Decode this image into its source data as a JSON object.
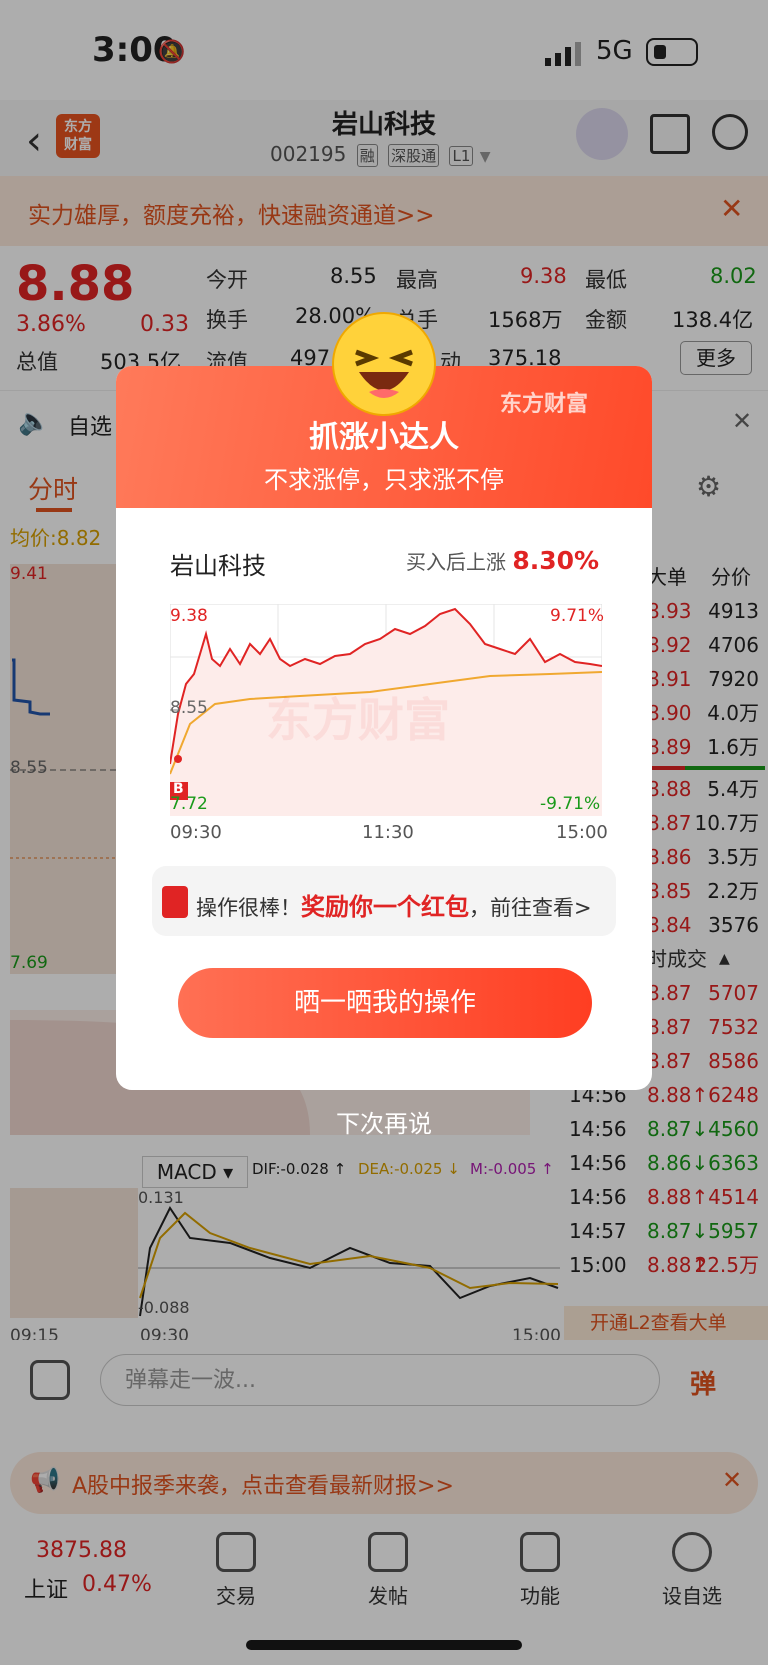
{
  "status": {
    "time": "3:00",
    "network": "5G"
  },
  "header": {
    "name": "岩山科技",
    "code": "002195",
    "tags": [
      "融",
      "深股通",
      "L1"
    ]
  },
  "logo": {
    "line1": "东方",
    "line2": "财富"
  },
  "promo": {
    "text": "实力雄厚，额度充裕，快速融资通道>>"
  },
  "quote": {
    "price": "8.88",
    "change_pct": "3.86%",
    "change": "0.33",
    "fields": [
      {
        "label": "今开",
        "value": "8.55"
      },
      {
        "label": "最高",
        "value": "9.38"
      },
      {
        "label": "最低",
        "value": "8.02"
      },
      {
        "label": "换手",
        "value": "28.00%"
      },
      {
        "label": "总手",
        "value": "1568万"
      },
      {
        "label": "金额",
        "value": "138.4亿"
      },
      {
        "label": "总值",
        "value": "503.5亿"
      },
      {
        "label": "流值",
        "value": "497"
      },
      {
        "label": "动",
        "value": "375.18"
      }
    ],
    "more": "更多"
  },
  "notice": {
    "text": "自选"
  },
  "tabs": {
    "active": "分时"
  },
  "chart_left": {
    "avg_label": "均价:",
    "avg_value": "8.82",
    "y_top": "9.41",
    "y_mid": "8.55",
    "y_bottom": "7.69",
    "t1": "09:15",
    "t2": "09:30",
    "t3": "15:00",
    "macd": "MACD",
    "dif": "DIF:-0.028 ↑",
    "dea": "DEA:-0.025 ↓",
    "m": "M:-0.005 ↑",
    "macd_top": "0.131",
    "macd_bottom": "-0.088"
  },
  "order_book": {
    "header_big": "大单",
    "header_price": "分价",
    "rows": [
      {
        "p": "8.93",
        "v": "4913"
      },
      {
        "p": "8.92",
        "v": "4706"
      },
      {
        "p": "8.91",
        "v": "7920"
      },
      {
        "p": "8.90",
        "v": "4.0万"
      },
      {
        "p": "8.89",
        "v": "1.6万"
      },
      {
        "p": "8.88",
        "v": "5.4万"
      },
      {
        "p": "8.87",
        "v": "10.7万"
      },
      {
        "p": "8.86",
        "v": "3.5万"
      },
      {
        "p": "8.85",
        "v": "2.2万"
      },
      {
        "p": "8.84",
        "v": "3576"
      }
    ],
    "ticks_title": "时成交",
    "ticks": [
      {
        "t": "",
        "p": "8.87",
        "v": "5707"
      },
      {
        "t": "",
        "p": "8.87",
        "v": "7532"
      },
      {
        "t": "",
        "p": "8.87",
        "v": "8586"
      },
      {
        "t": "14:56",
        "p": "8.88↑",
        "v": "6248"
      },
      {
        "t": "14:56",
        "p": "8.87↓",
        "v": "4560"
      },
      {
        "t": "14:56",
        "p": "8.86↓",
        "v": "6363"
      },
      {
        "t": "14:56",
        "p": "8.88↑",
        "v": "4514"
      },
      {
        "t": "14:57",
        "p": "8.87↓",
        "v": "5957"
      },
      {
        "t": "15:00",
        "p": "8.88↑",
        "v": "22.5万"
      }
    ],
    "l2": "开通L2查看大单"
  },
  "popup": {
    "brand": "东方财富",
    "title": "抓涨小达人",
    "subtitle": "不求涨停，只求涨不停",
    "stock": "岩山科技",
    "rise_label": "买入后上涨",
    "rise_value": "8.30%",
    "chart": {
      "y_top": "9.38",
      "y_mid": "8.55",
      "y_bottom": "7.72",
      "pct_top": "9.71%",
      "pct_bottom": "-9.71%",
      "t1": "09:30",
      "t2": "11:30",
      "t3": "15:00",
      "buy_mark": "B",
      "watermark": "东方财富"
    },
    "reward_prefix": "操作很棒！",
    "reward_highlight": "奖励你一个红包",
    "reward_suffix": "，前往查看>",
    "share_button": "晒一晒我的操作",
    "later": "下次再说"
  },
  "danmu": {
    "placeholder": "弹幕走一波...",
    "button": "弹"
  },
  "report": {
    "text": "A股中报季来袭，点击查看最新财报>>"
  },
  "bottom_nav": {
    "index_value": "3875.88",
    "index_name": "上证",
    "index_change": "0.47%",
    "items": [
      "交易",
      "发帖",
      "功能",
      "设自选"
    ]
  }
}
